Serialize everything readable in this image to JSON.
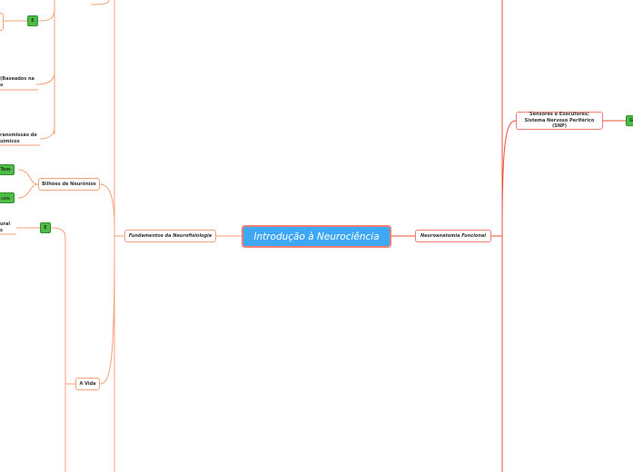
{
  "root": {
    "title": "Introdução à Neurociência"
  },
  "left": {
    "fundamentos": "Fundamentos da Neurofisiologia",
    "bilhoes": "Bilhões de Neurônios",
    "vida": "A Vida",
    "partial_node_1": "(Baseados na\no",
    "partial_node_2": "ransmissão de\nuímicos",
    "partial_node_3": "ural\ns",
    "badge_top": "E",
    "badge_tem": "Tem",
    "badge_tem2": "cete",
    "badge_e2": "E"
  },
  "right": {
    "neuroanatomia": "Neuroanatomia Funcional",
    "sensores": "Sensores e Executores: Sistema Nervoso Periférico (SNP)",
    "badge_right": "G"
  },
  "colors": {
    "root_fill": "#3fa8f4",
    "root_border": "#f07f73",
    "left_lines": "#f4a27a",
    "right_lines": "#e8503a",
    "badge": "#4dbb45"
  }
}
